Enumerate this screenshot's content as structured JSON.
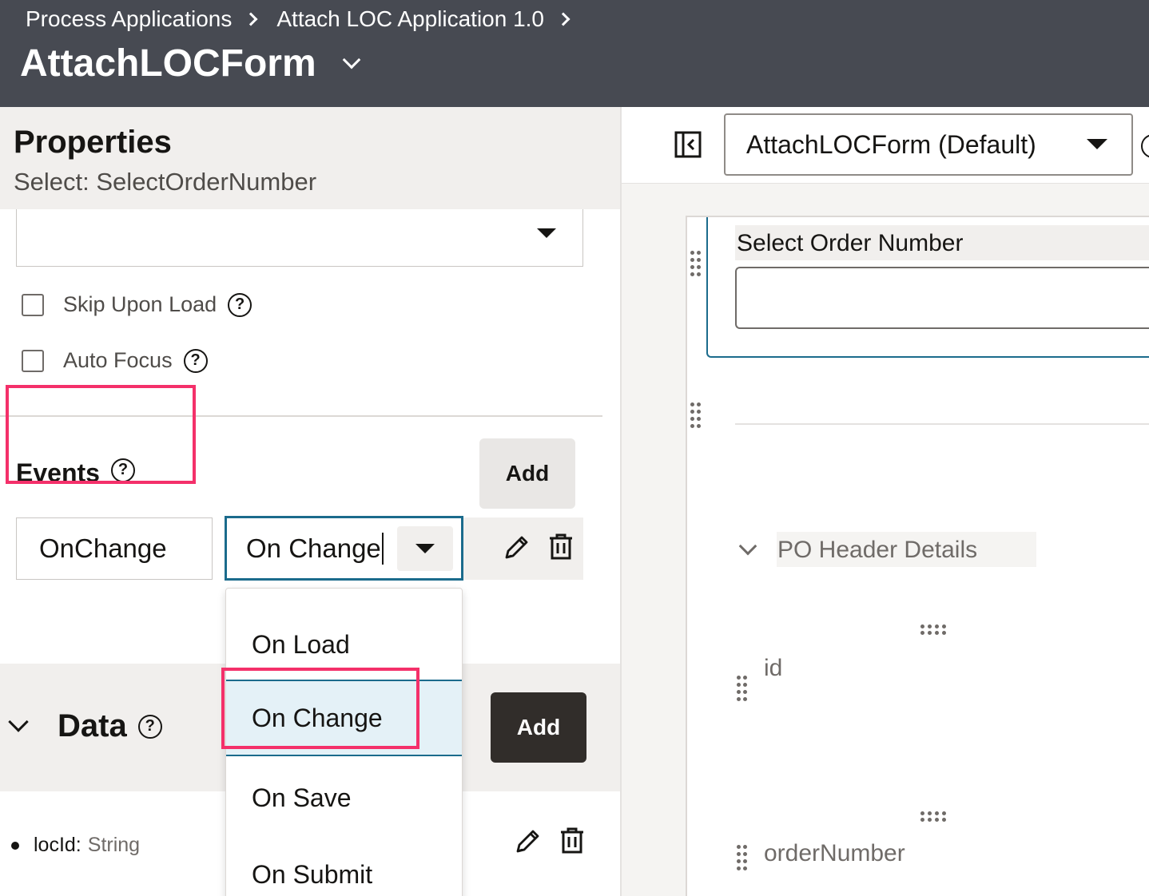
{
  "header": {
    "breadcrumbs": [
      "Process Applications",
      "Attach LOC Application 1.0"
    ],
    "title": "AttachLOCForm"
  },
  "properties": {
    "title": "Properties",
    "subtitle": "Select: SelectOrderNumber",
    "checkboxes": [
      {
        "label": "Skip Upon Load",
        "checked": false
      },
      {
        "label": "Auto Focus",
        "checked": false
      }
    ],
    "help_glyph": "?"
  },
  "events": {
    "label": "Events",
    "add_label": "Add",
    "row": {
      "name": "OnChange",
      "type": "On Change"
    },
    "options": [
      "On Load",
      "On Change",
      "On Save",
      "On Submit"
    ],
    "selected_option": "On Change"
  },
  "data": {
    "label": "Data",
    "add_label": "Add",
    "items": [
      {
        "name": "locId:",
        "type": "String"
      }
    ]
  },
  "canvas": {
    "layout_select": "AttachLOCForm (Default)",
    "field_label": "Select Order Number",
    "section_label": "PO Header Details",
    "fields": [
      "id",
      "orderNumber"
    ]
  },
  "colors": {
    "header_bg": "#474a52",
    "highlight": "#f4306a",
    "focus": "#1b6b8c",
    "selected_bg": "#e4f1f7",
    "dark_button": "#312d2a"
  }
}
